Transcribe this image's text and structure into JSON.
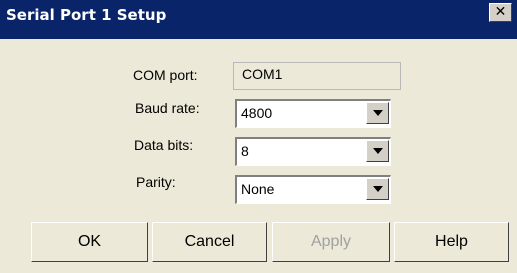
{
  "window": {
    "title": "Serial Port 1 Setup",
    "close_glyph": "✕"
  },
  "form": {
    "com_port": {
      "label": "COM port:",
      "value": "COM1"
    },
    "baud_rate": {
      "label": "Baud rate:",
      "value": "4800"
    },
    "data_bits": {
      "label": "Data bits:",
      "value": "8"
    },
    "parity": {
      "label": "Parity:",
      "value": "None"
    }
  },
  "buttons": {
    "ok": "OK",
    "cancel": "Cancel",
    "apply": "Apply",
    "help": "Help"
  }
}
